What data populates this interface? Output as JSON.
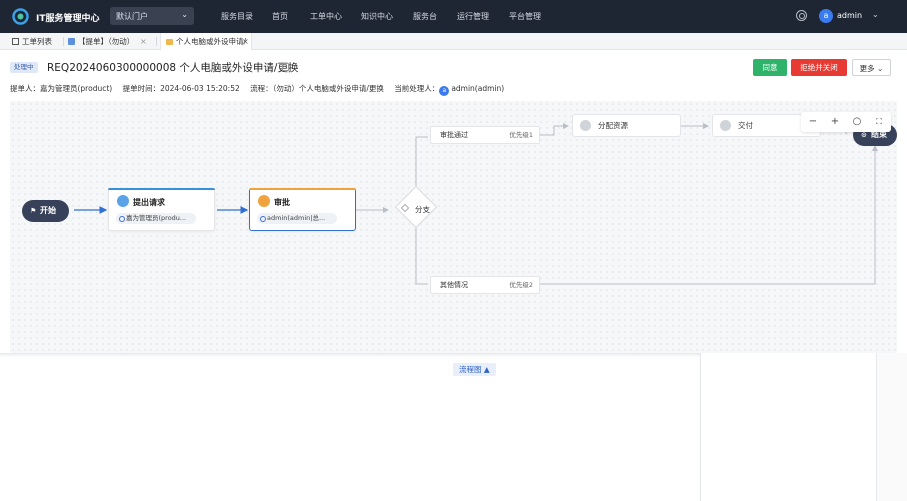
{
  "app": {
    "title": "IT服务管理中心",
    "portal": "默认门户"
  },
  "nav": [
    "服务目录",
    "首页",
    "工单中心",
    "知识中心",
    "服务台",
    "运行管理",
    "平台管理"
  ],
  "user": {
    "name": "admin",
    "avatar_letter": "a"
  },
  "tabs": [
    {
      "label": "工单列表"
    },
    {
      "label": "【提单】（勿动）"
    },
    {
      "label": "个人电脑或外设申请/"
    }
  ],
  "ticket": {
    "status": "处理中",
    "title": "REQ2024060300000008 个人电脑或外设申请/更换",
    "submitter": "提单人：嘉为管理员(product)",
    "submit_time": "提单时间：2024-06-03 15:20:52",
    "process": "流程：（勿动）个人电脑或外设申请/更换",
    "handler_label": "当前处理人：",
    "handler": "admin(admin)",
    "handler_avatar": "a"
  },
  "buttons": {
    "approve": "同意",
    "reject": "拒绝并关闭",
    "more": "更多"
  },
  "flow": {
    "start": "开始",
    "end": "结束",
    "submit": {
      "title": "提出请求",
      "assignee": "嘉为管理员(produ..."
    },
    "approve": {
      "title": "审批",
      "assignee": "admin(admin|总..."
    },
    "branch": "分支",
    "cond1": {
      "label": "审批通过",
      "priority": "优先级1"
    },
    "cond2": {
      "label": "其他情况",
      "priority": "优先级2"
    },
    "assign": "分配资源",
    "deliver": "交付"
  },
  "tools": {
    "zoom_out": "−",
    "zoom_in": "+",
    "reset": "○",
    "fullscreen": "⛶"
  },
  "bottom_tab": "流程图 ▲",
  "colors": {
    "nav_bg": "#1f2633",
    "approve": "#2fb36b",
    "reject": "#e63a32",
    "accent": "#2f6fd6",
    "orange": "#f0a23c"
  }
}
